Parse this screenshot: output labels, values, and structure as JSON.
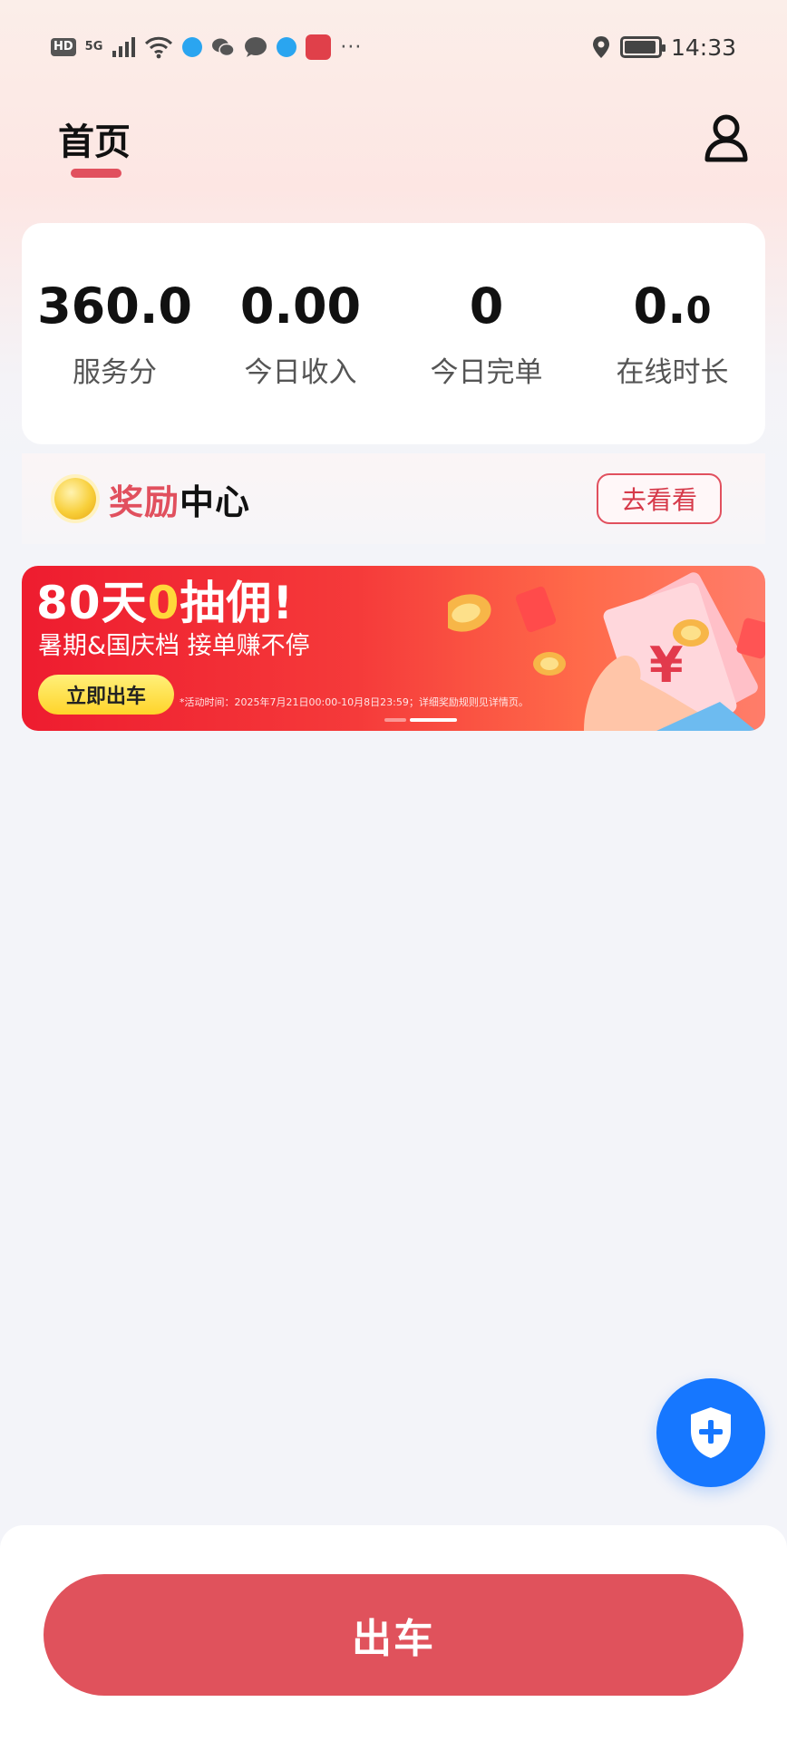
{
  "status_bar": {
    "hd_label": "HD",
    "network_label": "5G",
    "time": "14:33",
    "more": "···",
    "icons": [
      "signal-icon",
      "wifi-icon",
      "app-notification-icon",
      "wechat-icon",
      "message-icon",
      "app-notification-icon",
      "huawei-app-icon",
      "location-icon",
      "battery-icon"
    ]
  },
  "header": {
    "title": "首页",
    "accent_color": "#e1505e"
  },
  "stats": [
    {
      "value_main": "360.0",
      "value_frac": "",
      "label": "服务分"
    },
    {
      "value_main": "0.00",
      "value_frac": "",
      "label": "今日收入"
    },
    {
      "value_main": "0",
      "value_frac": "",
      "label": "今日完单"
    },
    {
      "value_main": "0.",
      "value_frac": "0",
      "label": "在线时长"
    }
  ],
  "rewards": {
    "title_red": "奖励",
    "title_dark": "中心",
    "button_label": "去看看"
  },
  "banner": {
    "headline_part1": "80天",
    "headline_highlight": "0",
    "headline_part2": "抽佣!",
    "subtitle": "暑期&国庆档 接单赚不停",
    "cta_label": "立即出车",
    "note": "*活动时间：2025年7月21日00:00-10月8日23:59；详细奖励规则见详情页。",
    "currency_symbol": "¥",
    "page_count": 2,
    "active_page": 2
  },
  "shield_fab": {
    "icon": "shield-plus-icon",
    "color": "#1677ff"
  },
  "bottom": {
    "depart_label": "出车",
    "button_color": "#e0525c"
  }
}
